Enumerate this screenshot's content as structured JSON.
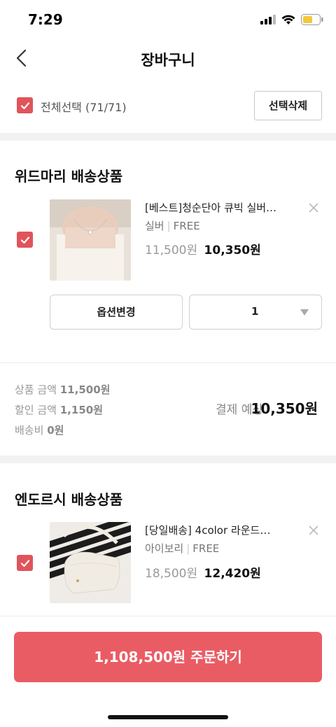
{
  "status": {
    "time": "7:29"
  },
  "nav": {
    "title": "장바구니"
  },
  "select_all": {
    "label": "전체선택 (71/71)",
    "delete_label": "선택삭제"
  },
  "groups": [
    {
      "title": "위드마리 배송상품",
      "item": {
        "name": "[베스트]청순단아 큐빅 실버…",
        "option": "실버",
        "size": "FREE",
        "original_price": "11,500원",
        "sale_price": "10,350원"
      },
      "option_change_label": "옵션변경",
      "quantity": "1",
      "summary": {
        "product_label": "상품 금액",
        "product_value": "11,500원",
        "discount_label": "할인 금액",
        "discount_value": "1,150원",
        "shipping_label": "배송비",
        "shipping_value": "0원",
        "pay_label": "결제 예상",
        "pay_value": "10,350원"
      }
    },
    {
      "title": "엔도르시 배송상품",
      "item": {
        "name": "[당일배송] 4color 라운드…",
        "option": "아이보리",
        "size": "FREE",
        "original_price": "18,500원",
        "sale_price": "12,420원"
      }
    }
  ],
  "order_button": {
    "label": "1,108,500원 주문하기"
  },
  "colors": {
    "accent": "#ea5c64",
    "checkbox": "#e0545b"
  }
}
